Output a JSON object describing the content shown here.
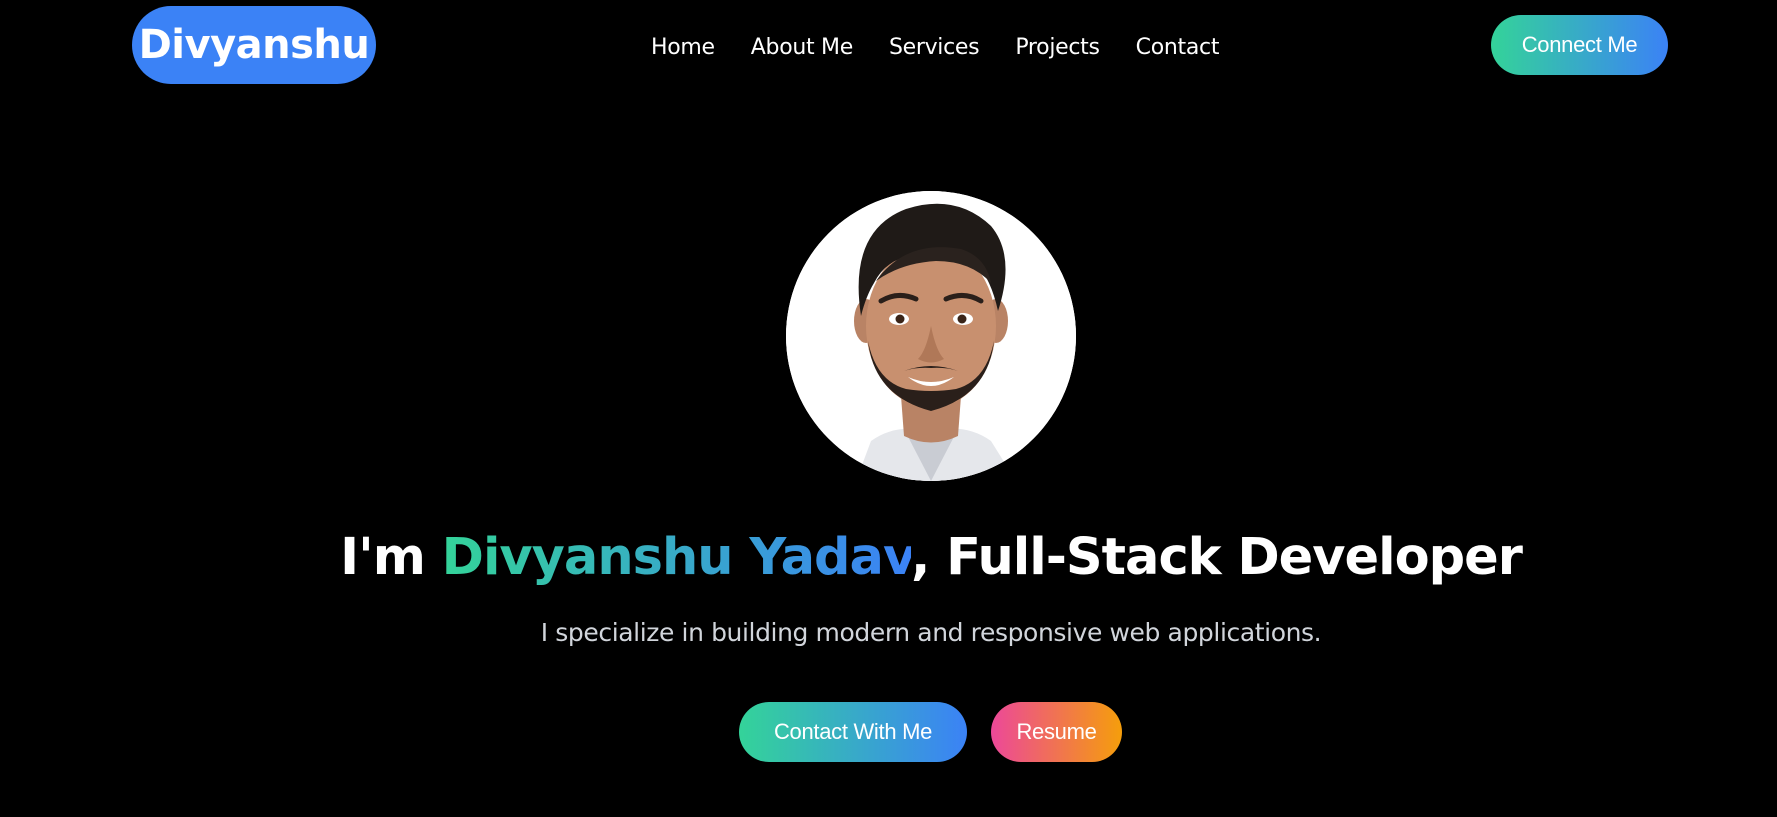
{
  "brand": {
    "name": "Divyanshu"
  },
  "nav": {
    "items": [
      {
        "label": "Home"
      },
      {
        "label": "About Me"
      },
      {
        "label": "Services"
      },
      {
        "label": "Projects"
      },
      {
        "label": "Contact"
      }
    ],
    "connect_label": "Connect Me"
  },
  "hero": {
    "avatar_icon": "profile-photo",
    "headline_prefix": "I'm ",
    "headline_name": "Divyanshu Yadav",
    "headline_suffix": ", Full-Stack Developer",
    "subtitle": "I specialize in building modern and responsive web applications.",
    "primary_button": "Contact With Me",
    "secondary_button": "Resume"
  },
  "colors": {
    "background": "#000000",
    "brand_blue": "#3b82f6",
    "gradient_green": "#34d399",
    "gradient_pink": "#ec4899",
    "gradient_amber": "#f59e0b"
  }
}
